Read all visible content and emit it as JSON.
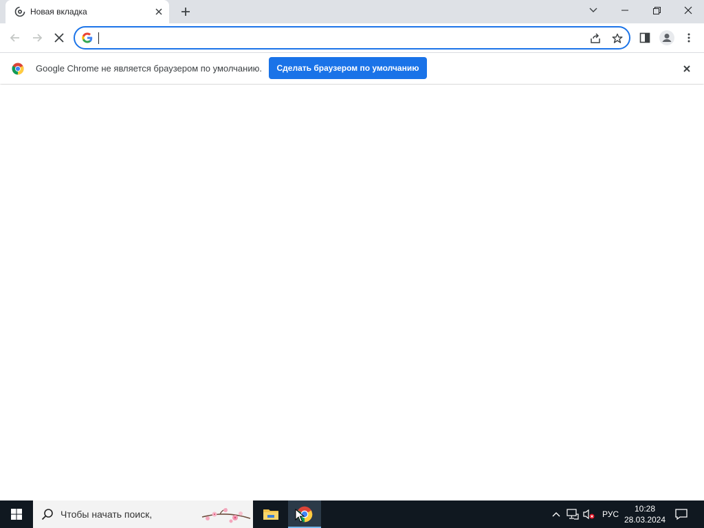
{
  "browser": {
    "tab": {
      "title": "Новая вкладка",
      "favicon": "loading-spinner-icon"
    },
    "omnibox": {
      "value": "",
      "placeholder": ""
    },
    "infobar": {
      "message": "Google Chrome не является браузером по умолчанию.",
      "button_label": "Сделать браузером по умолчанию"
    },
    "colors": {
      "accent": "#1a73e8",
      "tabstrip": "#dee1e6"
    }
  },
  "taskbar": {
    "search_placeholder": "Чтобы начать поиск,",
    "language": "РУС",
    "time": "10:28",
    "date": "28.03.2024",
    "apps": [
      "file-explorer-icon",
      "chrome-icon"
    ]
  }
}
